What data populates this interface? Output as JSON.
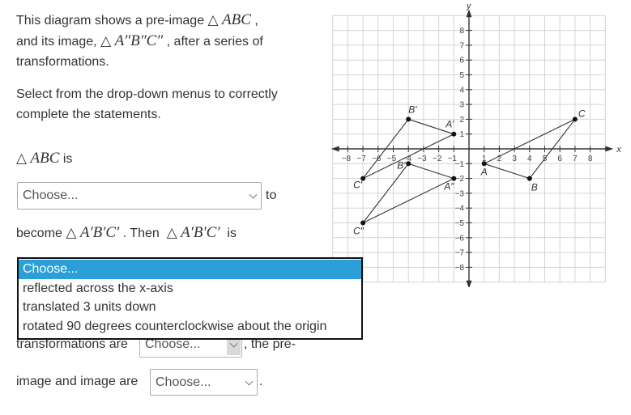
{
  "intro": {
    "line1_prefix": "This diagram shows a pre-image",
    "line1_triangle": "ABC",
    "line1_suffix": ",",
    "line2_prefix": "and its image,",
    "line2_triangle": "A″B″C″",
    "line2_suffix": ", after a series of",
    "line3": "transformations."
  },
  "instructions": {
    "line1": "Select from the drop-down menus to correctly",
    "line2": "complete the statements."
  },
  "statement": {
    "tri_symbol": "△",
    "abc": "ABC",
    "is": "is",
    "to": "to",
    "become": "become",
    "aprime": "A′B′C′",
    "then": ". Then",
    "is2": "is",
    "transformations_are": "transformations are",
    "the_pre": ", the pre-",
    "image_and_image_are": "image and image are",
    "period": "."
  },
  "selects": [
    {
      "value": "Choose..."
    },
    {
      "value": "Choose...",
      "open": true
    },
    {
      "value": "Choose..."
    },
    {
      "value": "Choose..."
    }
  ],
  "dropdown_options": [
    "Choose...",
    "reflected across the x-axis",
    "translated 3 units down",
    "rotated 90 degrees counterclockwise about the origin"
  ],
  "colors": {
    "highlight": "#2a9fd8"
  },
  "graph": {
    "x_label": "x",
    "y_label": "y",
    "x_ticks": [
      -8,
      -7,
      -6,
      -5,
      -4,
      -3,
      -2,
      -1,
      1,
      2,
      3,
      4,
      5,
      6,
      7,
      8
    ],
    "y_ticks": [
      -8,
      -7,
      -6,
      -5,
      -4,
      -3,
      -2,
      -1,
      1,
      2,
      3,
      4,
      5,
      6,
      7,
      8
    ],
    "triangles": [
      {
        "name": "ABC",
        "points": [
          {
            "label": "A",
            "x": 1,
            "y": -1
          },
          {
            "label": "B",
            "x": 4,
            "y": -2
          },
          {
            "label": "C",
            "x": 7,
            "y": 2
          }
        ]
      },
      {
        "name": "A'B'C'",
        "points": [
          {
            "label": "A′",
            "x": -1,
            "y": 1
          },
          {
            "label": "B′",
            "x": -4,
            "y": 2
          },
          {
            "label": "C′",
            "x": -7,
            "y": -2
          }
        ]
      },
      {
        "name": "A''B''C''",
        "points": [
          {
            "label": "A″",
            "x": -1,
            "y": -2
          },
          {
            "label": "B″",
            "x": -4,
            "y": -1
          },
          {
            "label": "C″",
            "x": -7,
            "y": -5
          }
        ]
      }
    ]
  }
}
